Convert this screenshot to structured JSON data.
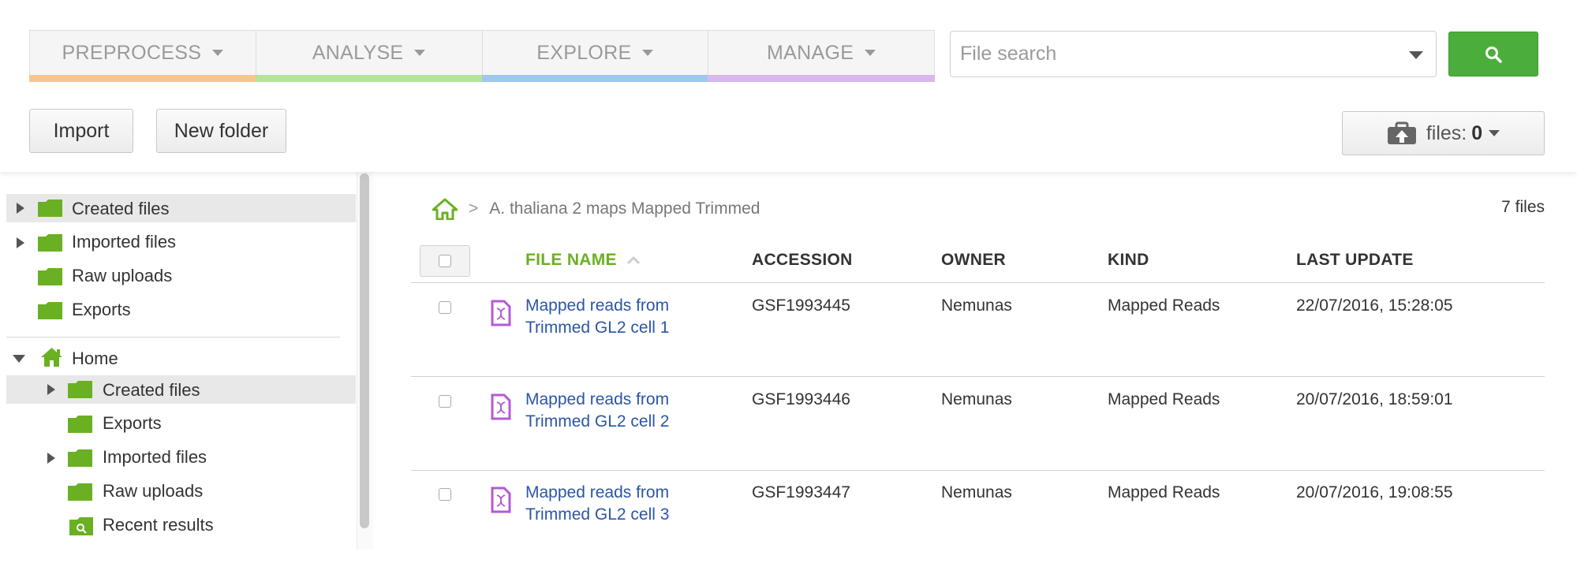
{
  "nav": {
    "tabs": [
      {
        "label": "PREPROCESS",
        "color": "#f7c58e"
      },
      {
        "label": "ANALYSE",
        "color": "#b6e39a"
      },
      {
        "label": "EXPLORE",
        "color": "#9ec8ee"
      },
      {
        "label": "MANAGE",
        "color": "#d9b8ee"
      }
    ],
    "search_placeholder": "File search",
    "search_icon": "magnifier-icon"
  },
  "toolbar": {
    "import_label": "Import",
    "new_folder_label": "New folder",
    "files_label": "files:",
    "files_count": "0",
    "files_icon": "briefcase-upload-icon"
  },
  "sidebar": {
    "items": [
      {
        "label": "Created files",
        "selected": true,
        "expandable": true,
        "icon": "folder-icon"
      },
      {
        "label": "Imported files",
        "selected": false,
        "expandable": true,
        "icon": "folder-icon"
      },
      {
        "label": "Raw uploads",
        "selected": false,
        "expandable": false,
        "icon": "folder-icon"
      },
      {
        "label": "Exports",
        "selected": false,
        "expandable": false,
        "icon": "folder-icon"
      },
      {
        "label": "Home",
        "selected": false,
        "expanded": true,
        "icon": "home-icon"
      },
      {
        "label": "Created files",
        "selected": true,
        "expandable": true,
        "icon": "folder-icon"
      },
      {
        "label": "Exports",
        "selected": false,
        "expandable": false,
        "icon": "folder-icon"
      },
      {
        "label": "Imported files",
        "selected": false,
        "expandable": true,
        "icon": "folder-icon"
      },
      {
        "label": "Raw uploads",
        "selected": false,
        "expandable": false,
        "icon": "folder-icon"
      },
      {
        "label": "Recent results",
        "selected": false,
        "expandable": false,
        "icon": "recent-results-icon"
      }
    ]
  },
  "breadcrumb": {
    "separator": ">",
    "current": "A. thaliana 2 maps Mapped Trimmed"
  },
  "file_count": "7 files",
  "table": {
    "columns": [
      "FILE NAME",
      "ACCESSION",
      "OWNER",
      "KIND",
      "LAST UPDATE"
    ],
    "rows": [
      {
        "name": "Mapped reads from Trimmed GL2 cell 1",
        "accession": "GSF1993445",
        "owner": "Nemunas",
        "kind": "Mapped Reads",
        "updated": "22/07/2016, 15:28:05"
      },
      {
        "name": "Mapped reads from Trimmed GL2 cell 2",
        "accession": "GSF1993446",
        "owner": "Nemunas",
        "kind": "Mapped Reads",
        "updated": "20/07/2016, 18:59:01"
      },
      {
        "name": "Mapped reads from Trimmed GL2 cell 3",
        "accession": "GSF1993447",
        "owner": "Nemunas",
        "kind": "Mapped Reads",
        "updated": "20/07/2016, 19:08:55"
      }
    ]
  },
  "colors": {
    "accent_green": "#4bae3a",
    "folder_green": "#6ab023",
    "link_blue": "#2b55a8",
    "file_icon_purple": "#b45ad6"
  }
}
